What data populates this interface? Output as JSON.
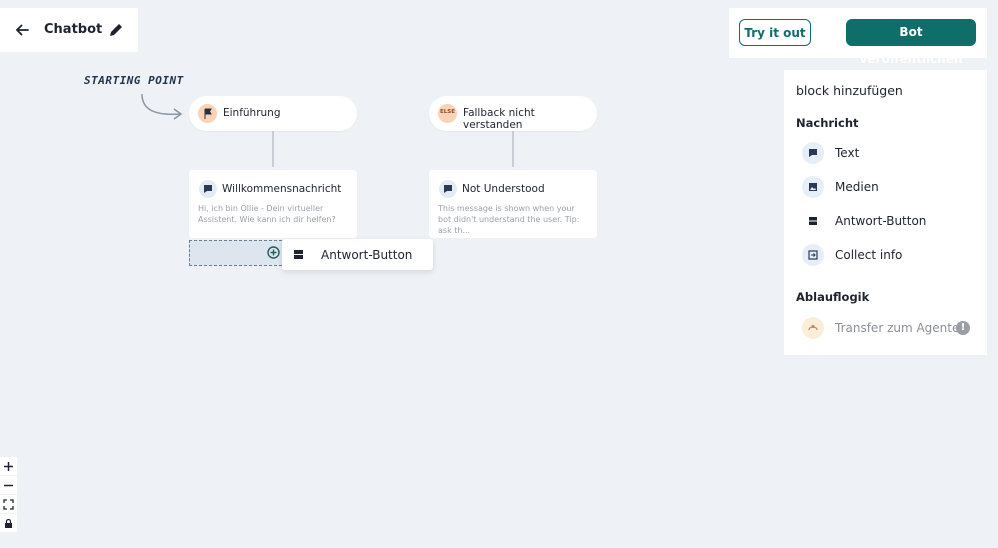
{
  "header": {
    "title": "Chatbot",
    "back_icon": "arrow-left-icon",
    "edit_icon": "pencil-icon"
  },
  "actions": {
    "try_label": "Try it out",
    "publish_label": "Bot veröffentlichen",
    "accent": "#0f6d6a"
  },
  "canvas": {
    "starting_point": "STARTING POINT",
    "triggers": [
      {
        "label": "Einführung",
        "icon": "flag-icon"
      },
      {
        "label": "Fallback nicht verstanden",
        "icon": "else-icon",
        "icon_text": "ELSE"
      }
    ],
    "cards": [
      {
        "title": "Willkommensnachricht",
        "body": "Hi, ich bin Ollie - Dein virtueller Assistent. Wie kann ich dir helfen?",
        "icon": "message-icon"
      },
      {
        "title": "Not Understood",
        "body": "This message is shown when your bot didn't understand the user. Tip: ask th...",
        "icon": "message-icon"
      }
    ],
    "dragging": {
      "label": "Antwort-Button",
      "icon": "button-block-icon"
    }
  },
  "sidebar": {
    "title": "block hinzufügen",
    "section_message": "Nachricht",
    "items": [
      {
        "label": "Text",
        "icon": "message-icon"
      },
      {
        "label": "Medien",
        "icon": "image-icon"
      },
      {
        "label": "Antwort-Button",
        "icon": "button-block-icon"
      },
      {
        "label": "Collect info",
        "icon": "input-icon"
      }
    ],
    "section_logic": "Ablauflogik",
    "logic_items": [
      {
        "label": "Transfer zum Agenten",
        "icon": "agent-icon",
        "badge": "!"
      }
    ]
  },
  "zoom": {
    "buttons": [
      "zoom-in-icon",
      "zoom-out-icon",
      "fit-view-icon",
      "lock-icon"
    ]
  }
}
